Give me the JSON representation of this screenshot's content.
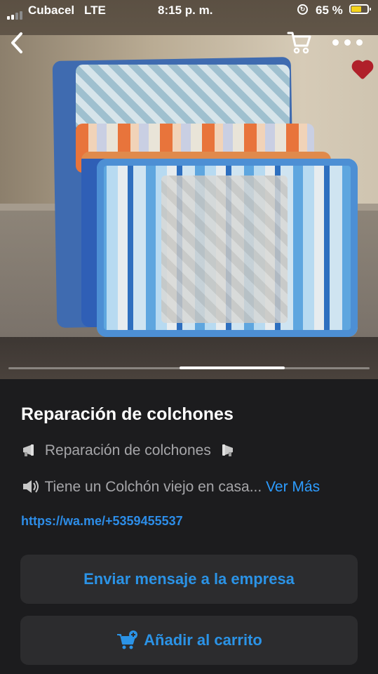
{
  "status_bar": {
    "carrier": "Cubacel",
    "network": "LTE",
    "time": "8:15 p. m.",
    "battery_percent": "65 %",
    "battery_level": 0.65,
    "battery_color": "#f4d21c"
  },
  "nav": {
    "back_icon": "chevron-left-icon",
    "cart_icon": "cart-icon",
    "more_icon": "more-icon"
  },
  "gallery": {
    "image_description_icon": "mattress-photo",
    "active_page_index": 1,
    "page_count": 3
  },
  "product": {
    "title": "Reparación de colchones",
    "line1_text": "Reparación de colchones",
    "line2_text": "Tiene un Colchón viejo en casa...",
    "see_more": "Ver Más",
    "link": "https://wa.me/+5359455537"
  },
  "actions": {
    "message_button": "Enviar mensaje a la empresa",
    "cart_button": "Añadir al carrito"
  },
  "colors": {
    "accent": "#2b93e6",
    "background": "#1c1c1e",
    "button_bg": "#2c2c2e"
  }
}
